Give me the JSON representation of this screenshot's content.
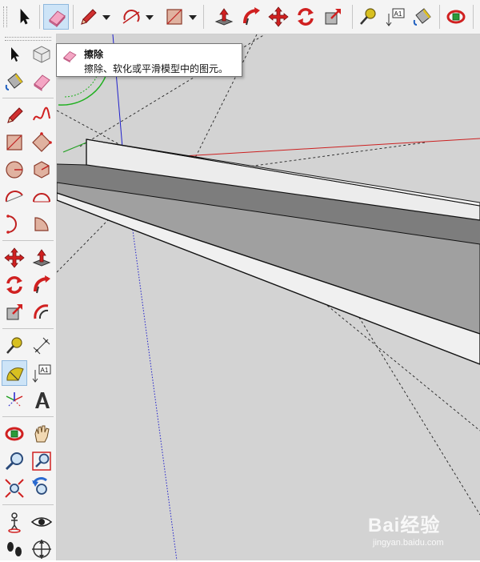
{
  "tooltip": {
    "title": "擦除",
    "description": "擦除、软化或平滑模型中的图元。"
  },
  "toolbar_icons": [
    "select-icon",
    "eraser-icon",
    "pencil-icon",
    "arc-icon",
    "rectangle-icon",
    "push-pull-icon",
    "follow-me-icon",
    "move-icon",
    "rotate-icon",
    "scale-icon",
    "tape-measure-icon",
    "text-icon",
    "paint-bucket-icon",
    "orbit-icon"
  ],
  "left_toolbar_icons": [
    "select-icon",
    "make-component-icon",
    "paint-bucket-icon",
    "eraser-icon",
    "line-icon",
    "freehand-icon",
    "rectangle-icon",
    "rotated-rectangle-icon",
    "circle-icon",
    "polygon-icon",
    "arc-icon",
    "two-point-arc-icon",
    "three-point-arc-icon",
    "pie-icon",
    "move-icon",
    "push-pull-icon",
    "rotate-icon",
    "follow-me-icon",
    "scale-icon",
    "offset-icon",
    "tape-measure-icon",
    "dimension-icon",
    "protractor-icon",
    "text-icon",
    "axes-icon",
    "3d-text-icon",
    "orbit-icon",
    "pan-icon",
    "zoom-icon",
    "zoom-window-icon",
    "zoom-extents-icon",
    "previous-view-icon",
    "position-camera-icon",
    "look-around-icon",
    "walk-icon",
    "section-plane-icon"
  ],
  "text_tool_label": "A1",
  "watermark": {
    "logo": "Bai经验",
    "url": "jingyan.baidu.com"
  },
  "colors": {
    "toolbar_bg": "#f4f4f4",
    "viewport_bg": "#d3d3d3",
    "selected_bg": "#cde4f7",
    "red_axis": "#cc2020",
    "green_axis": "#20a020",
    "blue_axis": "#2020cc"
  }
}
